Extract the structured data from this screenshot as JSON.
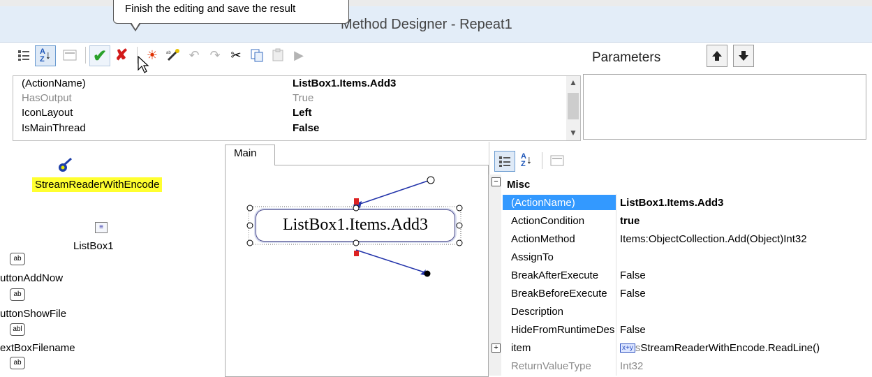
{
  "window": {
    "title": "Method Designer - Repeat1"
  },
  "tooltip": {
    "text": "Finish the editing and save the result"
  },
  "toolbar": {
    "buttons": [
      {
        "icon": "categorized-icon"
      },
      {
        "icon": "sort-alpha-icon"
      },
      {
        "icon": "property-pages-icon"
      },
      {
        "icon": "checkmark-icon",
        "color": "#2aa12a"
      },
      {
        "icon": "cancel-x-icon",
        "color": "#d21a1a"
      },
      {
        "icon": "sun-icon"
      },
      {
        "icon": "magic-wand-icon"
      },
      {
        "icon": "undo-icon"
      },
      {
        "icon": "redo-icon"
      },
      {
        "icon": "cut-icon"
      },
      {
        "icon": "copy-icon"
      },
      {
        "icon": "paste-icon"
      },
      {
        "icon": "run-icon"
      }
    ]
  },
  "parameters": {
    "label": "Parameters",
    "up_icon": "move-up-icon",
    "down_icon": "move-down-icon"
  },
  "top_grid": {
    "rows": [
      {
        "key": "(ActionName)",
        "value": "ListBox1.Items.Add3"
      },
      {
        "key": "HasOutput",
        "value": "True"
      },
      {
        "key": "IconLayout",
        "value": "Left"
      },
      {
        "key": "IsMainThread",
        "value": "False"
      }
    ]
  },
  "left_panel": {
    "stream_reader": "StreamReaderWithEncode",
    "listbox": "ListBox1",
    "buttons": [
      {
        "icon_text": "ab",
        "label": "uttonAddNow"
      },
      {
        "icon_text": "ab",
        "label": "uttonShowFile"
      },
      {
        "icon_text": "abl",
        "label": "extBoxFilename"
      },
      {
        "icon_text": "ab",
        "label": ""
      }
    ]
  },
  "canvas": {
    "tab": "Main",
    "action_label": "ListBox1.Items.Add3"
  },
  "right_grid": {
    "section": "Misc",
    "rows": [
      {
        "key": "(ActionName)",
        "value": "ListBox1.Items.Add3"
      },
      {
        "key": "ActionCondition",
        "value": "true"
      },
      {
        "key": "ActionMethod",
        "value": "Items:ObjectCollection.Add(Object)Int32"
      },
      {
        "key": "AssignTo",
        "value": ""
      },
      {
        "key": "BreakAfterExecute",
        "value": "False"
      },
      {
        "key": "BreakBeforeExecute",
        "value": "False"
      },
      {
        "key": "Description",
        "value": ""
      },
      {
        "key": "HideFromRuntimeDesigner",
        "value": "False"
      },
      {
        "key": "item",
        "value": "StreamReaderWithEncode.ReadLine()",
        "value_prefix": "x+y",
        "value_cut": "s"
      },
      {
        "key": "ReturnValueType",
        "value": "Int32"
      }
    ]
  },
  "colors": {
    "highlight": "#ffff30",
    "selected_row": "#3399ff",
    "titlebar": "#e3edf8"
  }
}
